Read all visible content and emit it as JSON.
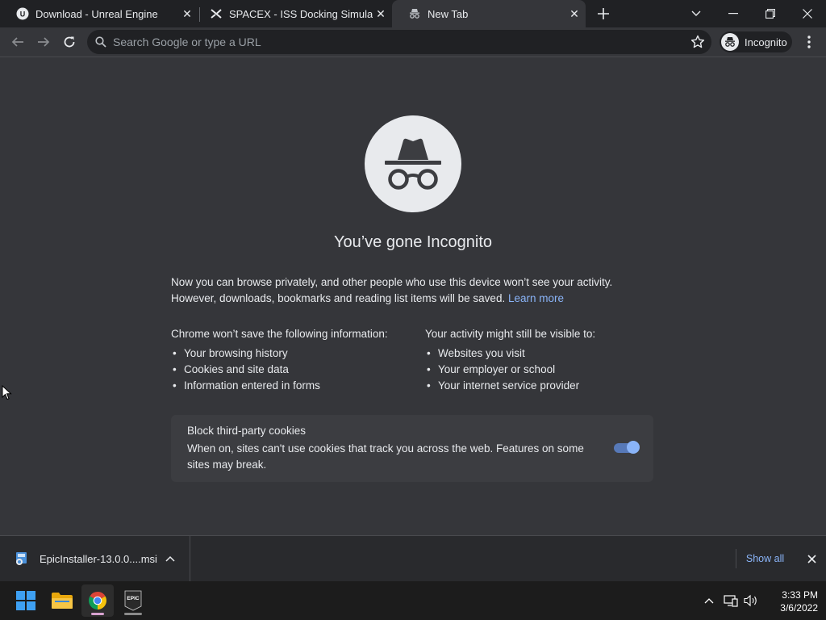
{
  "tabs": [
    {
      "title": "Download - Unreal Engine",
      "icon": "unreal-engine-icon",
      "active": false
    },
    {
      "title": "SPACEX - ISS Docking Simulator",
      "icon": "spacex-icon",
      "active": false
    },
    {
      "title": "New Tab",
      "icon": "incognito-icon",
      "active": true
    }
  ],
  "omnibox": {
    "placeholder": "Search Google or type a URL"
  },
  "profile": {
    "label": "Incognito"
  },
  "page": {
    "headline": "You’ve gone Incognito",
    "intro_text": "Now you can browse privately, and other people who use this device won’t see your activity. However, downloads, bookmarks and reading list items will be saved.",
    "learn_more": "Learn more",
    "not_saved": {
      "heading": "Chrome won’t save the following information:",
      "items": [
        "Your browsing history",
        "Cookies and site data",
        "Information entered in forms"
      ]
    },
    "visible_to": {
      "heading": "Your activity might still be visible to:",
      "items": [
        "Websites you visit",
        "Your employer or school",
        "Your internet service provider"
      ]
    },
    "cookie_card": {
      "title": "Block third-party cookies",
      "description": "When on, sites can't use cookies that track you across the web. Features on some sites may break.",
      "toggle_on": true
    }
  },
  "download_shelf": {
    "file_name": "EpicInstaller-13.0.0....msi",
    "show_all": "Show all"
  },
  "taskbar": {
    "apps": [
      "windows-start-icon",
      "file-explorer-icon",
      "chrome-icon",
      "epic-games-icon"
    ],
    "epic_label": "EPIC",
    "time": "3:33 PM",
    "date": "3/6/2022"
  },
  "colors": {
    "background": "#35363a",
    "tabstrip": "#202124",
    "link": "#8ab4f8",
    "text": "#e8eaed"
  }
}
